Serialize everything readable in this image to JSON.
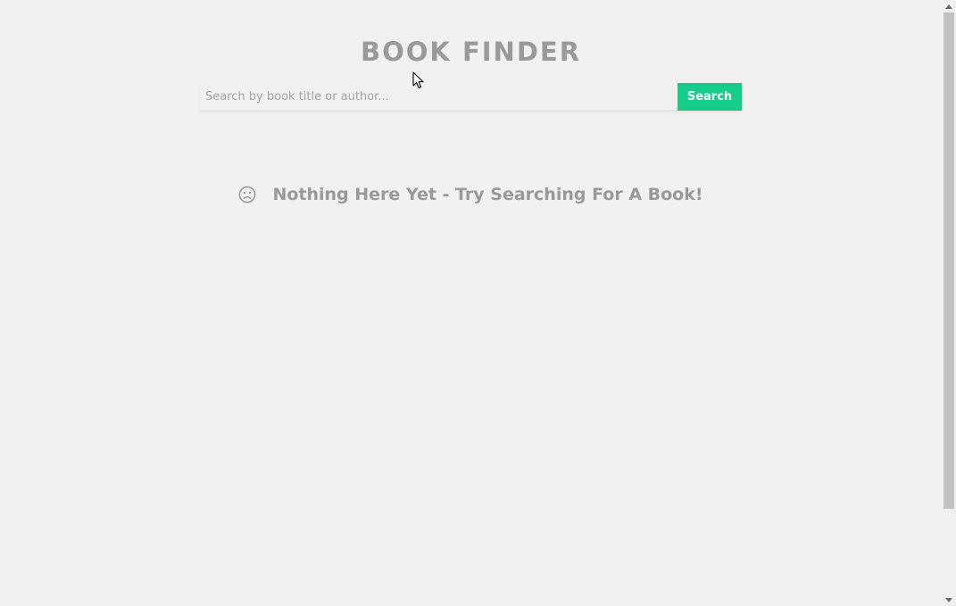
{
  "header": {
    "title": "BOOK FINDER"
  },
  "search": {
    "placeholder": "Search by book title or author...",
    "value": "",
    "button_label": "Search"
  },
  "empty_state": {
    "icon": "sad-face-icon",
    "message": "Nothing Here Yet - Try Searching For A Book!"
  },
  "colors": {
    "background": "#f1f1f1",
    "accent": "#16cc8a",
    "title_text": "#9a9a9a",
    "muted_text": "#999999"
  }
}
